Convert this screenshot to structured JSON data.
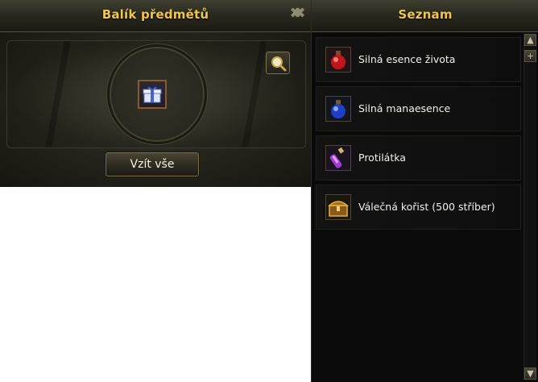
{
  "package_panel": {
    "title": "Balík předmětů",
    "close_glyph": "✖",
    "take_all_label": "Vzít vše",
    "slot_icon": "gift-box-icon",
    "inspect_icon": "magnifier-icon"
  },
  "list_panel": {
    "title": "Seznam",
    "close_glyph": "✖",
    "scroll_up_glyph": "▲",
    "scroll_plus_glyph": "+",
    "scroll_down_glyph": "▼",
    "items": [
      {
        "label": "Silná esence života",
        "icon": "red-potion-icon"
      },
      {
        "label": "Silná manaesence",
        "icon": "blue-potion-icon"
      },
      {
        "label": "Protilátka",
        "icon": "purple-vial-icon"
      },
      {
        "label": "Válečná kořist (500 stříber)",
        "icon": "treasure-chest-icon"
      }
    ]
  },
  "colors": {
    "title_gold": "#f0c64a",
    "panel_dark": "#14140d",
    "list_bg": "#0a0a0a"
  }
}
